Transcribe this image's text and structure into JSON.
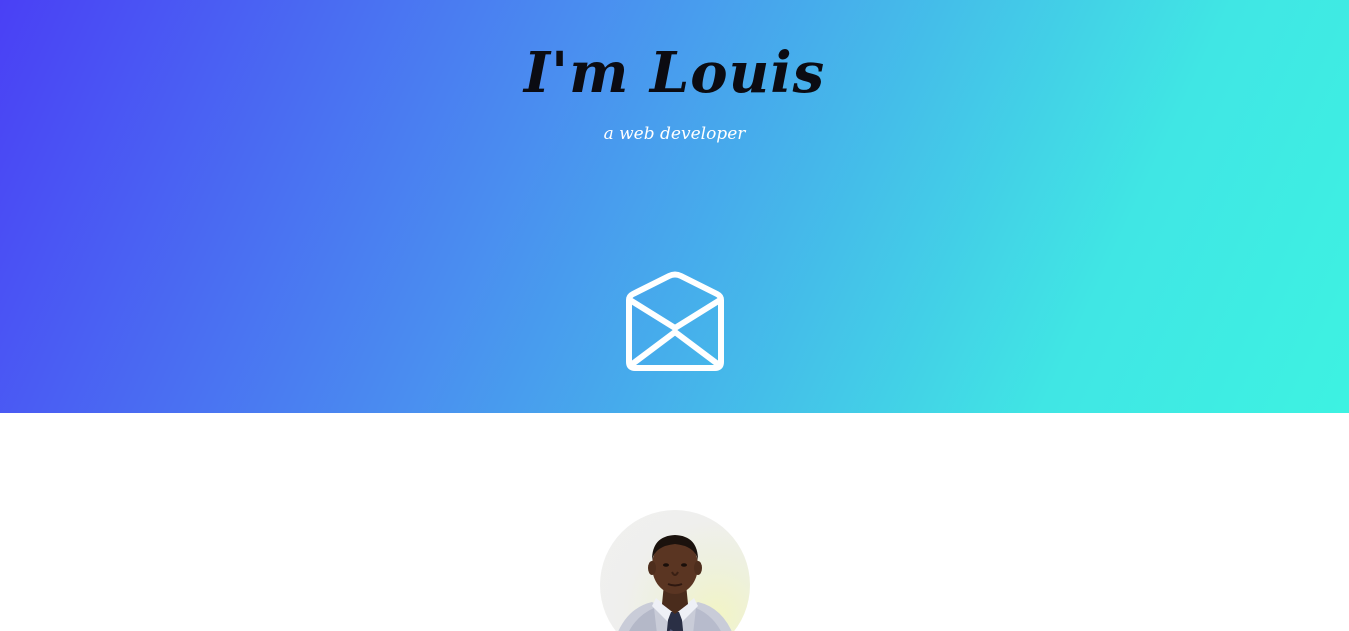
{
  "hero": {
    "title": "I'm Louis",
    "subtitle": "a web developer",
    "mail_icon": "envelope-open-icon"
  },
  "about": {
    "avatar": "avatar-photo"
  },
  "colors": {
    "gradient_start": "#4a40f5",
    "gradient_mid": "#45b7ea",
    "gradient_end": "#3df2e2",
    "title_color": "#0b0b12",
    "subtitle_color": "#ffffff"
  }
}
